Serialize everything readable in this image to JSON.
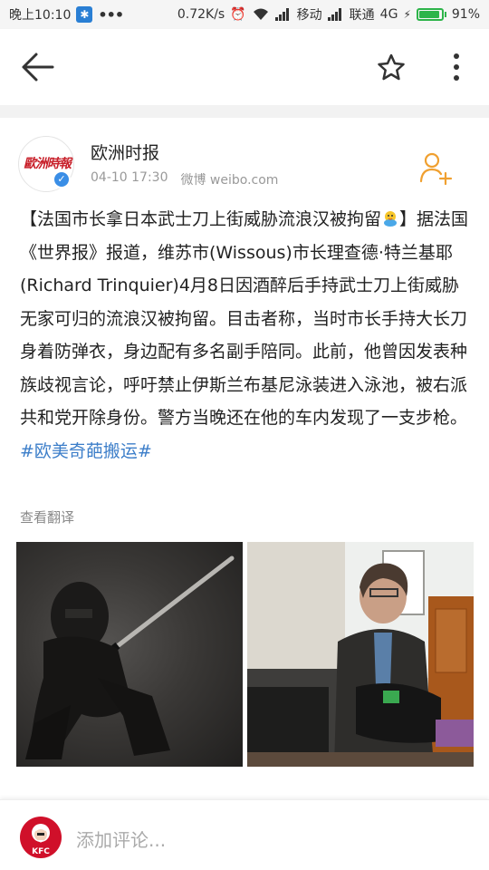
{
  "status_bar": {
    "time": "晚上10:10",
    "speed": "0.72K/s",
    "carrier1": "移动",
    "carrier2": "联通",
    "network": "4G",
    "battery_percent": "91%",
    "battery_level": 0.91
  },
  "toolbar": {
    "back_icon": "arrow-left",
    "favorite_icon": "star-outline",
    "more_icon": "vertical-dots"
  },
  "post": {
    "author": {
      "name": "欧洲时报",
      "avatar_text": "歐洲時報",
      "verified": true
    },
    "date": "04-10 17:30",
    "source": "微博 weibo.com",
    "text_part1": "【法国市长拿日本武士刀上街威胁流浪汉被拘留",
    "text_part2": "】据法国《世界报》报道，维苏市(Wissous)市长理查德·特兰基耶(Richard Trinquier)4月8日因酒醉后手持武士刀上街威胁无家可归的流浪汉被拘留。目击者称，当时市长手持大长刀身着防弹衣，身边配有多名副手陪同。此前，他曾因发表种族歧视言论，呼吁禁止伊斯兰布基尼泳装进入泳池，被右派共和党开除身份。警方当晚还在他的车内发现了一支步枪。",
    "hashtag": "#欧美奇葩搬运#",
    "translate_label": "查看翻译",
    "images": [
      {
        "description": "ninja with sword"
      },
      {
        "description": "man with bag"
      }
    ]
  },
  "bottom_bar": {
    "avatar_text": "KFC",
    "comment_placeholder": "添加评论..."
  },
  "colors": {
    "link": "#3c7ec9",
    "brand_red": "#c8202a",
    "follow_orange": "#f0a030",
    "battery_green": "#2db44a"
  }
}
